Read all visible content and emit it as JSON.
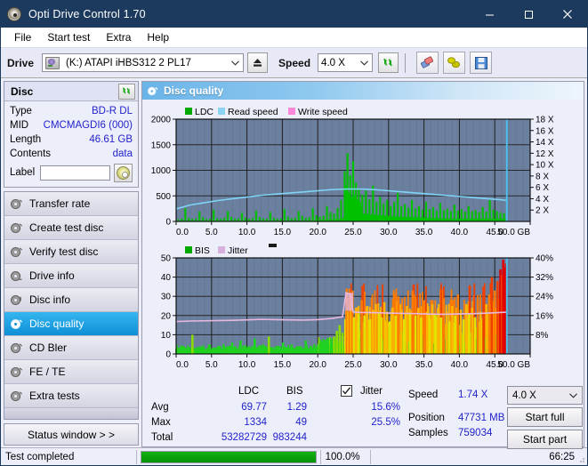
{
  "window": {
    "title": "Opti Drive Control 1.70",
    "icon": "disc-icon",
    "minimize": "–",
    "maximize": "□",
    "close": "✕"
  },
  "menu": {
    "items": [
      {
        "label": "File",
        "name": "menu-file"
      },
      {
        "label": "Start test",
        "name": "menu-start-test"
      },
      {
        "label": "Extra",
        "name": "menu-extra"
      },
      {
        "label": "Help",
        "name": "menu-help"
      }
    ]
  },
  "toolbar": {
    "drive_label": "Drive",
    "drive_value": "(K:)  ATAPI iHBS312  2 PL17",
    "eject_icon": "eject-icon",
    "speed_label": "Speed",
    "speed_value": "4.0 X",
    "refresh_icon": "refresh-icon",
    "erase_icon": "eraser-icon",
    "plug_icon": "plug-icon",
    "save_icon": "save-icon"
  },
  "disc_panel": {
    "title": "Disc",
    "refresh_icon": "refresh-icon",
    "rows": [
      {
        "key": "Type",
        "value": "BD-R DL"
      },
      {
        "key": "MID",
        "value": "CMCMAGDI6 (000)"
      },
      {
        "key": "Length",
        "value": "46.61 GB"
      },
      {
        "key": "Contents",
        "value": "data"
      }
    ],
    "label_key": "Label",
    "label_value": "",
    "label_placeholder": "",
    "disc_button_icon": "disc-icon"
  },
  "sidebar": {
    "items": [
      {
        "label": "Transfer rate",
        "name": "sidebar-item-transfer-rate",
        "active": false
      },
      {
        "label": "Create test disc",
        "name": "sidebar-item-create-test-disc",
        "active": false
      },
      {
        "label": "Verify test disc",
        "name": "sidebar-item-verify-test-disc",
        "active": false
      },
      {
        "label": "Drive info",
        "name": "sidebar-item-drive-info",
        "active": false
      },
      {
        "label": "Disc info",
        "name": "sidebar-item-disc-info",
        "active": false
      },
      {
        "label": "Disc quality",
        "name": "sidebar-item-disc-quality",
        "active": true
      },
      {
        "label": "CD Bler",
        "name": "sidebar-item-cd-bler",
        "active": false
      },
      {
        "label": "FE / TE",
        "name": "sidebar-item-fe-te",
        "active": false
      },
      {
        "label": "Extra tests",
        "name": "sidebar-item-extra-tests",
        "active": false
      }
    ],
    "status_window": "Status window > >"
  },
  "content": {
    "title": "Disc quality",
    "icon": "disc-quality-icon"
  },
  "stats": {
    "col_ldc": "LDC",
    "col_bis": "BIS",
    "col_jitter": "Jitter",
    "jitter_checked": true,
    "row_avg": "Avg",
    "row_max": "Max",
    "row_total": "Total",
    "ldc_avg": "69.77",
    "ldc_max": "1334",
    "ldc_total": "53282729",
    "bis_avg": "1.29",
    "bis_max": "49",
    "bis_total": "983244",
    "jitter_avg": "15.6%",
    "jitter_max": "25.5%",
    "speed_label": "Speed",
    "speed_value": "1.74 X",
    "position_label": "Position",
    "position_value": "47731 MB",
    "samples_label": "Samples",
    "samples_value": "759034",
    "speed_select": "4.0 X",
    "start_full": "Start full",
    "start_part": "Start part"
  },
  "statusbar": {
    "message": "Test completed",
    "progress_text": "100.0%",
    "progress_value": 100,
    "elapsed": "66:25"
  },
  "colors": {
    "title_bar": "#1c3a5e",
    "accent": "#2222cc",
    "ldc_green": "#00c000",
    "read_speed": "#7fd4f5",
    "write_speed": "#ff7fd4",
    "jitter_pink": "#e8b8e0",
    "plot_bg": "#6b7f9e",
    "progress_green": "#0d9f0d",
    "highlight_blue": "#1f9ede"
  },
  "chart_data": [
    {
      "type": "area",
      "name": "disc-quality-ldc-chart",
      "title": "",
      "xlabel": "GB",
      "ylabel": "",
      "xlim": [
        0,
        50
      ],
      "ylim": [
        0,
        2000
      ],
      "xticks": [
        "0.0",
        "5.0",
        "10.0",
        "15.0",
        "20.0",
        "25.0",
        "30.0",
        "35.0",
        "40.0",
        "45.0",
        "50.0 GB"
      ],
      "yticks": [
        0,
        500,
        1000,
        1500,
        2000
      ],
      "y2lim": [
        0,
        18
      ],
      "y2ticks": [
        "2 X",
        "4 X",
        "6 X",
        "8 X",
        "10 X",
        "12 X",
        "14 X",
        "16 X",
        "18 X"
      ],
      "grid": true,
      "legend": [
        {
          "label": "LDC",
          "color": "#00a800"
        },
        {
          "label": "Read speed",
          "color": "#8ad4f2"
        },
        {
          "label": "Write speed",
          "color": "#ff86d8"
        }
      ],
      "series": [
        {
          "name": "LDC",
          "color": "#00c000",
          "x": [
            0.3,
            0.8,
            1.3,
            1.8,
            2.3,
            2.8,
            3.3,
            3.8,
            4.3,
            4.8,
            5.3,
            5.8,
            6.3,
            6.8,
            7.3,
            7.8,
            8.3,
            8.8,
            9.3,
            9.8,
            10.3,
            10.8,
            11.3,
            11.8,
            12.3,
            12.8,
            13.3,
            13.8,
            14.3,
            14.8,
            15.3,
            15.8,
            16.3,
            16.8,
            17.3,
            17.8,
            18.3,
            18.8,
            19.3,
            19.8,
            20.3,
            20.8,
            21.3,
            21.8,
            22.3,
            22.8,
            23.3,
            23.8,
            24.0,
            24.2,
            24.4,
            24.6,
            24.8,
            25.0,
            25.2,
            25.4,
            25.6,
            25.8,
            26.0,
            26.3,
            26.8,
            27.3,
            27.8,
            28.3,
            28.8,
            29.3,
            29.8,
            30.3,
            30.8,
            31.3,
            31.8,
            32.3,
            32.8,
            33.3,
            33.8,
            34.3,
            34.8,
            35.3,
            35.8,
            36.3,
            36.8,
            37.3,
            37.8,
            38.3,
            38.8,
            39.3,
            39.8,
            40.3,
            40.8,
            41.3,
            41.8,
            42.3,
            42.8,
            43.3,
            43.8,
            44.3,
            44.8,
            45.3,
            45.8,
            46.3,
            46.6
          ],
          "y": [
            40,
            55,
            260,
            70,
            50,
            60,
            190,
            80,
            45,
            55,
            230,
            60,
            50,
            70,
            200,
            90,
            55,
            60,
            170,
            75,
            50,
            65,
            210,
            85,
            60,
            55,
            180,
            70,
            50,
            60,
            240,
            95,
            60,
            70,
            200,
            110,
            70,
            80,
            260,
            120,
            90,
            110,
            300,
            180,
            150,
            260,
            420,
            980,
            700,
            1334,
            560,
            900,
            480,
            1180,
            520,
            760,
            430,
            640,
            380,
            520,
            600,
            430,
            700,
            380,
            480,
            350,
            420,
            300,
            380,
            560,
            300,
            340,
            270,
            420,
            250,
            300,
            230,
            380,
            240,
            280,
            210,
            360,
            220,
            250,
            200,
            330,
            210,
            240,
            190,
            300,
            200,
            220,
            180,
            280,
            190,
            420,
            230,
            200,
            170,
            160
          ]
        },
        {
          "name": "Read speed",
          "color": "#8ad4f2",
          "x": [
            0,
            2,
            4,
            6,
            8,
            10,
            12,
            14,
            16,
            18,
            20,
            22,
            24,
            26,
            28,
            30,
            32,
            34,
            36,
            38,
            40,
            42,
            44,
            46,
            46.6
          ],
          "y_speed": [
            2.2,
            2.9,
            3.3,
            3.7,
            4.0,
            4.3,
            4.6,
            4.8,
            5.0,
            5.2,
            5.4,
            5.6,
            5.7,
            5.7,
            5.6,
            5.4,
            5.2,
            5.0,
            4.8,
            4.6,
            4.4,
            4.2,
            4.0,
            3.8,
            3.7
          ]
        }
      ],
      "marker_line": {
        "x": 46.7,
        "color": "#49c4f0"
      }
    },
    {
      "type": "bar",
      "name": "disc-quality-bis-chart",
      "title": "",
      "xlabel": "GB",
      "ylabel": "",
      "xlim": [
        0,
        50
      ],
      "ylim": [
        0,
        50
      ],
      "xticks": [
        "0.0",
        "5.0",
        "10.0",
        "15.0",
        "20.0",
        "25.0",
        "30.0",
        "35.0",
        "40.0",
        "45.0",
        "50.0 GB"
      ],
      "yticks": [
        0,
        10,
        20,
        30,
        40,
        50
      ],
      "y2lim": [
        0,
        40
      ],
      "y2ticks": [
        "8%",
        "16%",
        "24%",
        "32%",
        "40%"
      ],
      "grid": true,
      "legend": [
        {
          "label": "BIS",
          "color": "#00a800"
        },
        {
          "label": "Jitter",
          "color": "#d8b0e0"
        }
      ],
      "series": [
        {
          "name": "BIS",
          "color_low": "#00c000",
          "color_mid": "#e8e800",
          "color_high": "#ff8000",
          "color_max": "#e00000",
          "x": [
            0.3,
            0.7,
            1.1,
            1.5,
            1.9,
            2.3,
            2.7,
            3.1,
            3.5,
            3.9,
            4.3,
            4.7,
            5.1,
            5.5,
            5.9,
            6.3,
            6.7,
            7.1,
            7.5,
            7.9,
            8.3,
            8.7,
            9.1,
            9.5,
            9.9,
            10.3,
            10.7,
            11.1,
            11.5,
            11.9,
            12.3,
            12.7,
            13.1,
            13.5,
            13.9,
            14.3,
            14.7,
            15.1,
            15.5,
            15.9,
            16.3,
            16.7,
            17.1,
            17.5,
            17.9,
            18.3,
            18.7,
            19.1,
            19.5,
            19.9,
            20.3,
            20.7,
            21.1,
            21.5,
            21.9,
            22.3,
            22.7,
            23.1,
            23.5,
            23.9,
            24.1,
            24.3,
            24.5,
            24.7,
            24.9,
            25.1,
            25.4,
            25.8,
            26.2,
            26.6,
            27.0,
            27.4,
            27.8,
            28.2,
            28.6,
            29.0,
            29.4,
            29.8,
            30.2,
            30.6,
            31.0,
            31.4,
            31.8,
            32.2,
            32.6,
            33.0,
            33.4,
            33.8,
            34.2,
            34.6,
            35.0,
            35.4,
            35.8,
            36.2,
            36.6,
            37.0,
            37.4,
            37.8,
            38.2,
            38.6,
            39.0,
            39.4,
            39.8,
            40.2,
            40.6,
            41.0,
            41.4,
            41.8,
            42.2,
            42.6,
            43.0,
            43.4,
            43.8,
            44.2,
            44.6,
            45.0,
            45.4,
            45.8,
            46.0,
            46.2,
            46.4,
            46.6
          ],
          "y": [
            3,
            2,
            4,
            3,
            2,
            10,
            3,
            2,
            4,
            3,
            2,
            5,
            3,
            2,
            4,
            3,
            5,
            2,
            3,
            6,
            3,
            2,
            7,
            3,
            2,
            4,
            3,
            8,
            3,
            2,
            5,
            3,
            9,
            3,
            2,
            4,
            3,
            6,
            3,
            2,
            5,
            3,
            4,
            2,
            3,
            7,
            3,
            2,
            5,
            4,
            3,
            6,
            4,
            5,
            8,
            9,
            12,
            15,
            11,
            18,
            34,
            22,
            30,
            26,
            33,
            19,
            24,
            21,
            28,
            20,
            25,
            18,
            23,
            26,
            21,
            19,
            27,
            22,
            17,
            24,
            20,
            30,
            23,
            18,
            25,
            21,
            33,
            20,
            24,
            19,
            28,
            22,
            18,
            26,
            21,
            24,
            19,
            29,
            22,
            17,
            25,
            20,
            31,
            23,
            18,
            26,
            21,
            24,
            19,
            28,
            22,
            35,
            26,
            31,
            40,
            33,
            38,
            44,
            41,
            49,
            45,
            47
          ]
        },
        {
          "name": "Jitter",
          "color": "#e8b8e0",
          "x": [
            0,
            2,
            4,
            6,
            8,
            10,
            12,
            14,
            16,
            18,
            20,
            22,
            23.5,
            24,
            24.6,
            25,
            26,
            28,
            30,
            32,
            34,
            36,
            38,
            40,
            42,
            44,
            46,
            46.6
          ],
          "y_pct": [
            13.5,
            13.7,
            13.8,
            13.9,
            14.0,
            14.2,
            14.4,
            14.3,
            14.2,
            14.1,
            14.3,
            14.8,
            15.5,
            25.5,
            24.8,
            17.5,
            17.3,
            17.2,
            17.0,
            16.9,
            16.8,
            16.6,
            16.5,
            16.7,
            16.8,
            17.0,
            17.3,
            17.4
          ]
        }
      ],
      "marker_line": {
        "x": 46.7,
        "color": "#49c4f0"
      },
      "small_marker": true
    }
  ]
}
